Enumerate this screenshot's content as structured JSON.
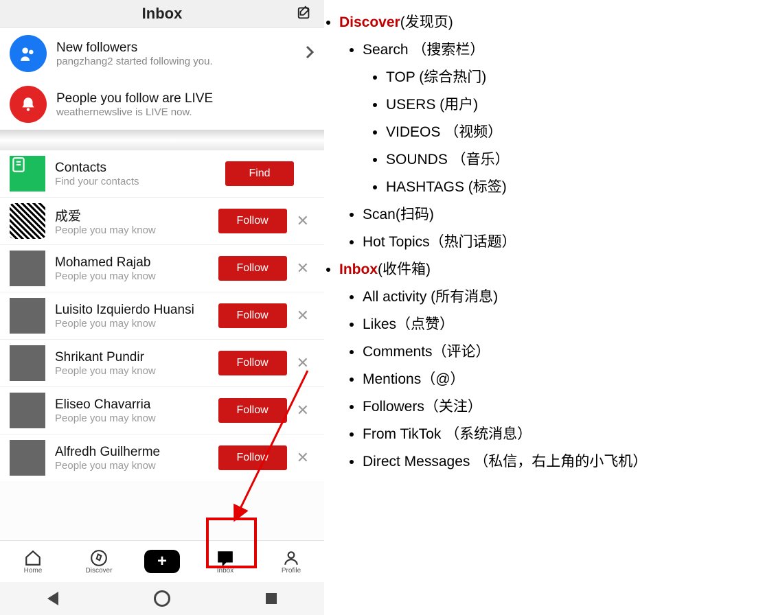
{
  "phone": {
    "title": "Inbox",
    "notif": {
      "followers": {
        "title": "New followers",
        "sub": "pangzhang2 started following you."
      },
      "live": {
        "title": "People you follow are LIVE",
        "sub": "weathernewslive is LIVE now."
      }
    },
    "contacts": {
      "title": "Contacts",
      "sub": "Find your contacts",
      "btn": "Find"
    },
    "suggest_label": "People you may know",
    "follow_btn": "Follow",
    "suggestions": [
      {
        "name": "成爱"
      },
      {
        "name": "Mohamed Rajab"
      },
      {
        "name": "Luisito Izquierdo Huansi"
      },
      {
        "name": "Shrikant Pundir"
      },
      {
        "name": "Eliseo Chavarria"
      },
      {
        "name": "Alfredh Guilherme"
      }
    ],
    "tabs": {
      "home": "Home",
      "discover": "Discover",
      "inbox": "Inbox",
      "profile": "Profile"
    }
  },
  "outline": {
    "discover": {
      "hdr": "Discover",
      "hdr_cn": "(发现页)",
      "search": {
        "label": "Search （搜索栏）",
        "items": [
          "TOP (综合热门)",
          "USERS (用户)",
          "VIDEOS （视频）",
          "SOUNDS （音乐）",
          "HASHTAGS (标签)"
        ]
      },
      "scan": "Scan(扫码)",
      "hot": "Hot Topics（热门话题）"
    },
    "inbox": {
      "hdr": "Inbox",
      "hdr_cn": "(收件箱)",
      "items": [
        "All activity (所有消息)",
        "Likes（点赞）",
        "Comments（评论）",
        "Mentions（@）",
        "Followers（关注）",
        "From TikTok （系统消息）",
        "Direct Messages （私信，右上角的小飞机）"
      ]
    }
  }
}
